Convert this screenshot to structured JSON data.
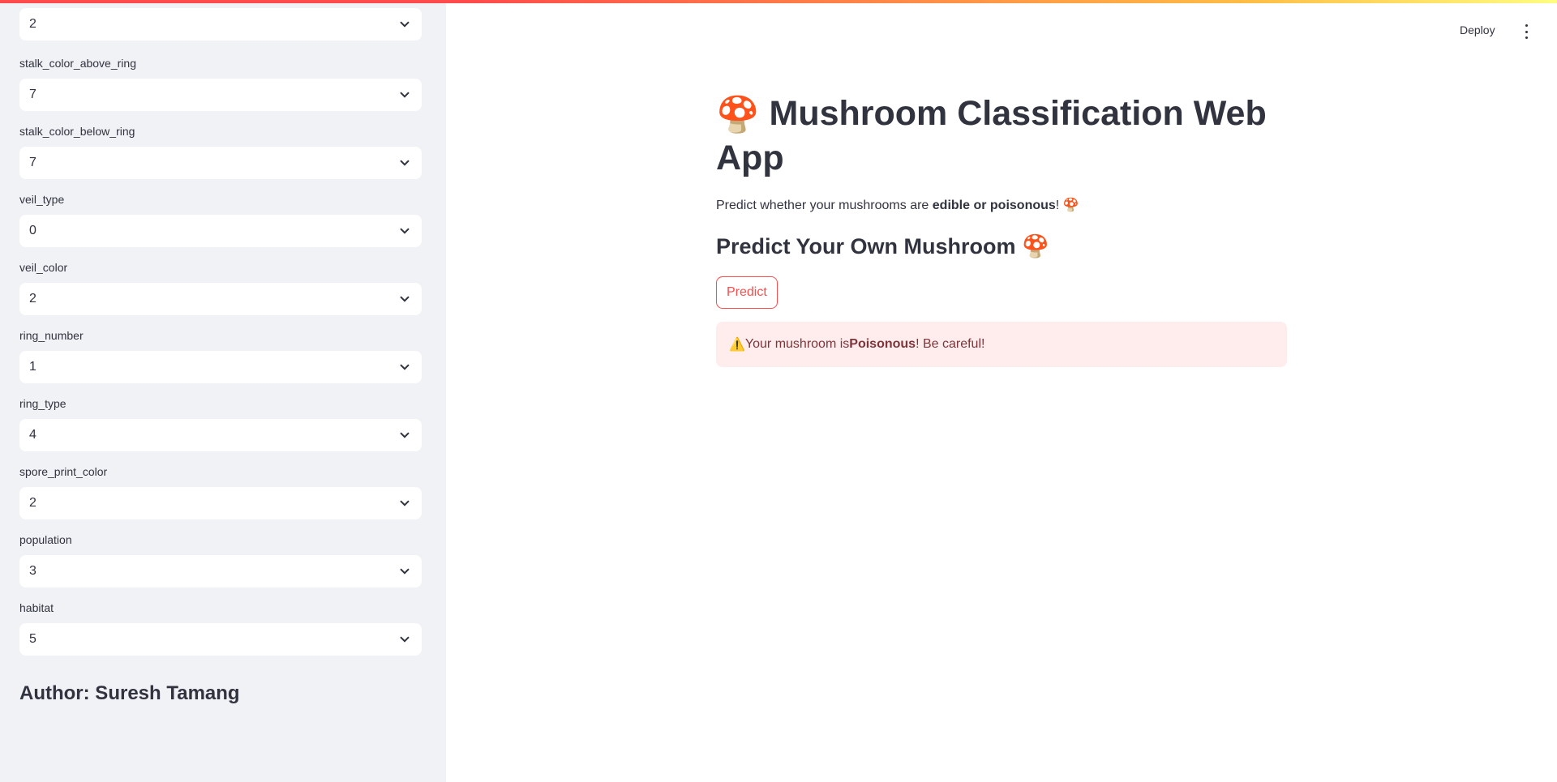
{
  "sidebar": {
    "fields": [
      {
        "label": "",
        "value": "2"
      },
      {
        "label": "stalk_color_above_ring",
        "value": "7"
      },
      {
        "label": "stalk_color_below_ring",
        "value": "7"
      },
      {
        "label": "veil_type",
        "value": "0"
      },
      {
        "label": "veil_color",
        "value": "2"
      },
      {
        "label": "ring_number",
        "value": "1"
      },
      {
        "label": "ring_type",
        "value": "4"
      },
      {
        "label": "spore_print_color",
        "value": "2"
      },
      {
        "label": "population",
        "value": "3"
      },
      {
        "label": "habitat",
        "value": "5"
      }
    ],
    "author": "Author: Suresh Tamang",
    "icon": "chevron-down-icon"
  },
  "header": {
    "deploy_label": "Deploy",
    "menu_icon": "vertical-ellipsis-icon"
  },
  "main": {
    "title_emoji": "🍄",
    "title": "Mushroom Classification Web App",
    "subtitle_pre": "Predict whether your mushrooms are ",
    "subtitle_bold": "edible or poisonous",
    "subtitle_post": "! 🍄",
    "section_title": "Predict Your Own Mushroom 🍄",
    "predict_label": "Predict",
    "alert_icon": "⚠️",
    "alert_pre": " Your mushroom is ",
    "alert_bold": "Poisonous",
    "alert_post": "! Be careful!"
  },
  "colors": {
    "accent": "#ff4b4b",
    "sidebar_bg": "#f0f2f6",
    "alert_bg": "#ffecec",
    "alert_text": "#7d353b"
  }
}
